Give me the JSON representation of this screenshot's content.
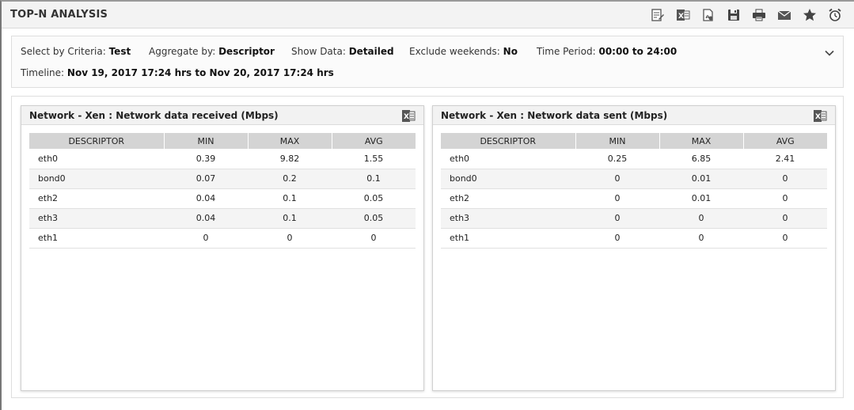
{
  "title": "TOP-N ANALYSIS",
  "toolbar": [
    "edit-report-icon",
    "excel-export-icon",
    "pdf-export-icon",
    "save-icon",
    "print-icon",
    "email-icon",
    "favorite-star-icon",
    "alarm-schedule-icon"
  ],
  "criteria": {
    "select_label": "Select by Criteria:",
    "select_value": "Test",
    "aggregate_label": "Aggregate by:",
    "aggregate_value": "Descriptor",
    "show_label": "Show Data:",
    "show_value": "Detailed",
    "weekends_label": "Exclude weekends:",
    "weekends_value": "No",
    "period_label": "Time Period:",
    "period_value": "00:00 to 24:00",
    "timeline_label": "Timeline:",
    "timeline_value": "Nov 19, 2017 17:24 hrs to Nov 20, 2017 17:24 hrs"
  },
  "panels": [
    {
      "title": "Network - Xen : Network data received (Mbps)",
      "columns": [
        "DESCRIPTOR",
        "MIN",
        "MAX",
        "AVG"
      ],
      "rows": [
        [
          "eth0",
          "0.39",
          "9.82",
          "1.55"
        ],
        [
          "bond0",
          "0.07",
          "0.2",
          "0.1"
        ],
        [
          "eth2",
          "0.04",
          "0.1",
          "0.05"
        ],
        [
          "eth3",
          "0.04",
          "0.1",
          "0.05"
        ],
        [
          "eth1",
          "0",
          "0",
          "0"
        ]
      ]
    },
    {
      "title": "Network - Xen : Network data sent (Mbps)",
      "columns": [
        "DESCRIPTOR",
        "MIN",
        "MAX",
        "AVG"
      ],
      "rows": [
        [
          "eth0",
          "0.25",
          "6.85",
          "2.41"
        ],
        [
          "bond0",
          "0",
          "0.01",
          "0"
        ],
        [
          "eth2",
          "0",
          "0.01",
          "0"
        ],
        [
          "eth3",
          "0",
          "0",
          "0"
        ],
        [
          "eth1",
          "0",
          "0",
          "0"
        ]
      ]
    }
  ]
}
